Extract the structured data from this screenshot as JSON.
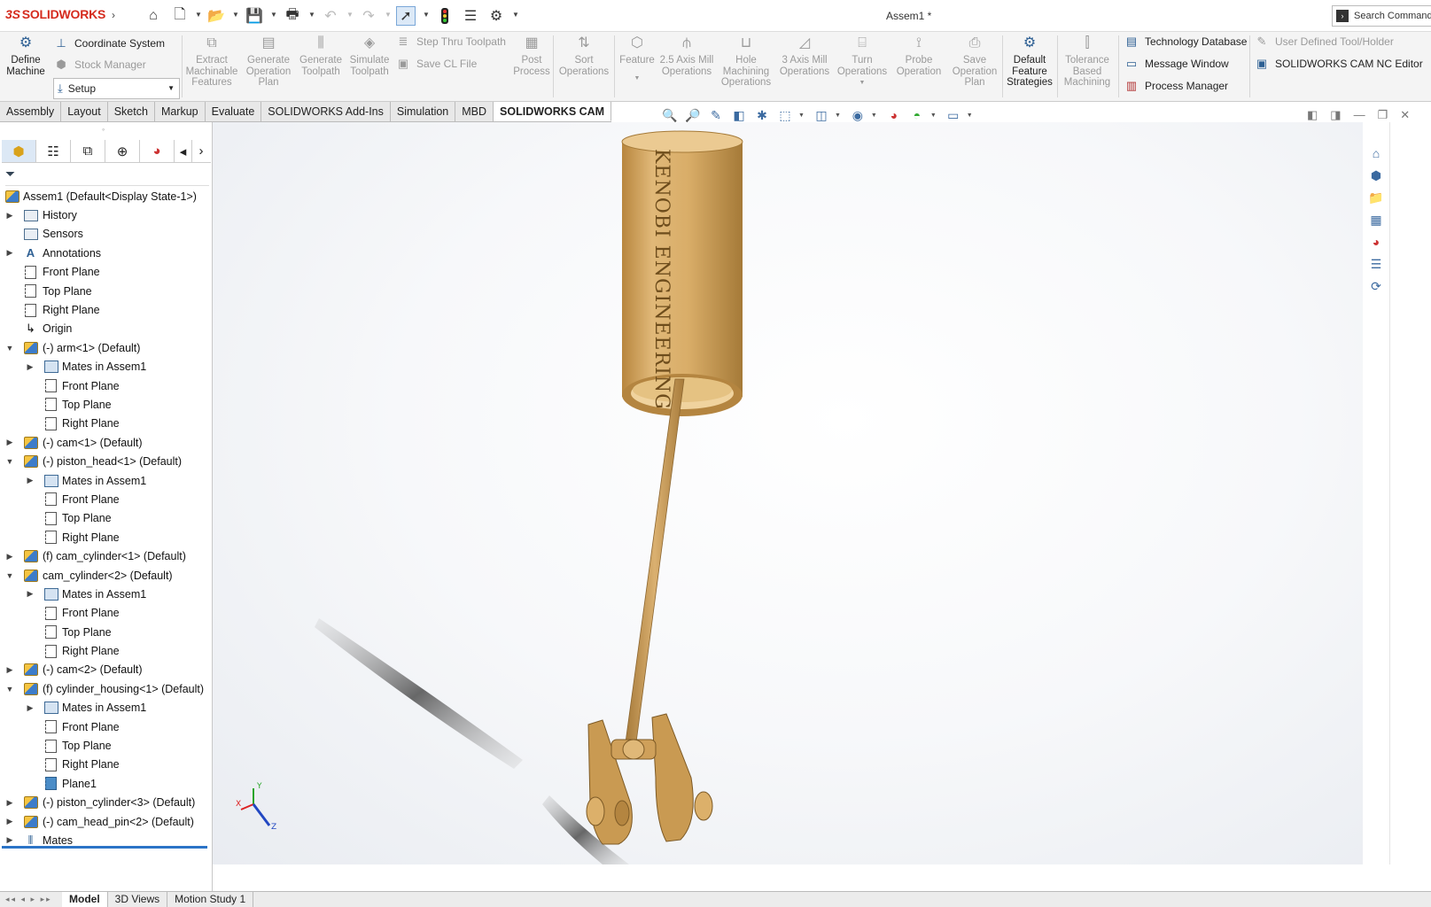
{
  "app": {
    "brand_ds": "3S",
    "brand_name": "SOLIDWORKS",
    "doc_title": "Assem1 *",
    "search_placeholder": "Search Commands"
  },
  "ribbon": {
    "define_machine": "Define Machine",
    "coordinate_system": "Coordinate System",
    "stock_manager": "Stock Manager",
    "setup": "Setup",
    "extract": "Extract Machinable Features",
    "gen_op_plan": "Generate Operation Plan",
    "gen_toolpath": "Generate Toolpath",
    "sim_toolpath": "Simulate Toolpath",
    "step_thru": "Step Thru Toolpath",
    "save_cl": "Save CL File",
    "post_process": "Post Process",
    "sort_ops": "Sort Operations",
    "feature": "Feature",
    "mill_25": "2.5 Axis Mill Operations",
    "hole_ops": "Hole Machining Operations",
    "mill_3": "3 Axis Mill Operations",
    "turn_ops": "Turn Operations",
    "probe_op": "Probe Operation",
    "save_op_plan": "Save Operation Plan",
    "default_strategies": "Default Feature Strategies",
    "tolerance": "Tolerance Based Machining",
    "tech_db": "Technology Database",
    "msg_window": "Message Window",
    "process_mgr": "Process Manager",
    "user_tool": "User Defined Tool/Holder",
    "cam_nc": "SOLIDWORKS CAM NC Editor"
  },
  "tabs": [
    "Assembly",
    "Layout",
    "Sketch",
    "Markup",
    "Evaluate",
    "SOLIDWORKS Add-Ins",
    "Simulation",
    "MBD",
    "SOLIDWORKS CAM"
  ],
  "tree": {
    "root": "Assem1  (Default<Display State-1>)",
    "items": [
      "History",
      "Sensors",
      "Annotations",
      "Front Plane",
      "Top Plane",
      "Right Plane",
      "Origin",
      "(-) arm<1> (Default)",
      "Mates in Assem1",
      "Front Plane",
      "Top Plane",
      "Right Plane",
      "(-) cam<1> (Default)",
      "(-) piston_head<1> (Default)",
      "Mates in Assem1",
      "Front Plane",
      "Top Plane",
      "Right Plane",
      "(f) cam_cylinder<1> (Default)",
      "cam_cylinder<2> (Default)",
      "Mates in Assem1",
      "Front Plane",
      "Top Plane",
      "Right Plane",
      "(-) cam<2> (Default)",
      "(f) cylinder_housing<1> (Default)",
      "Mates in Assem1",
      "Front Plane",
      "Top Plane",
      "Right Plane",
      "Plane1",
      "(-) piston_cylinder<3> (Default)",
      "(-) cam_head_pin<2> (Default)",
      "Mates"
    ]
  },
  "model": {
    "engraving": "KENOBI ENGINEERING"
  },
  "triad": {
    "x": "X",
    "y": "Y",
    "z": "Z"
  },
  "bottom_tabs": [
    "Model",
    "3D Views",
    "Motion Study 1"
  ]
}
